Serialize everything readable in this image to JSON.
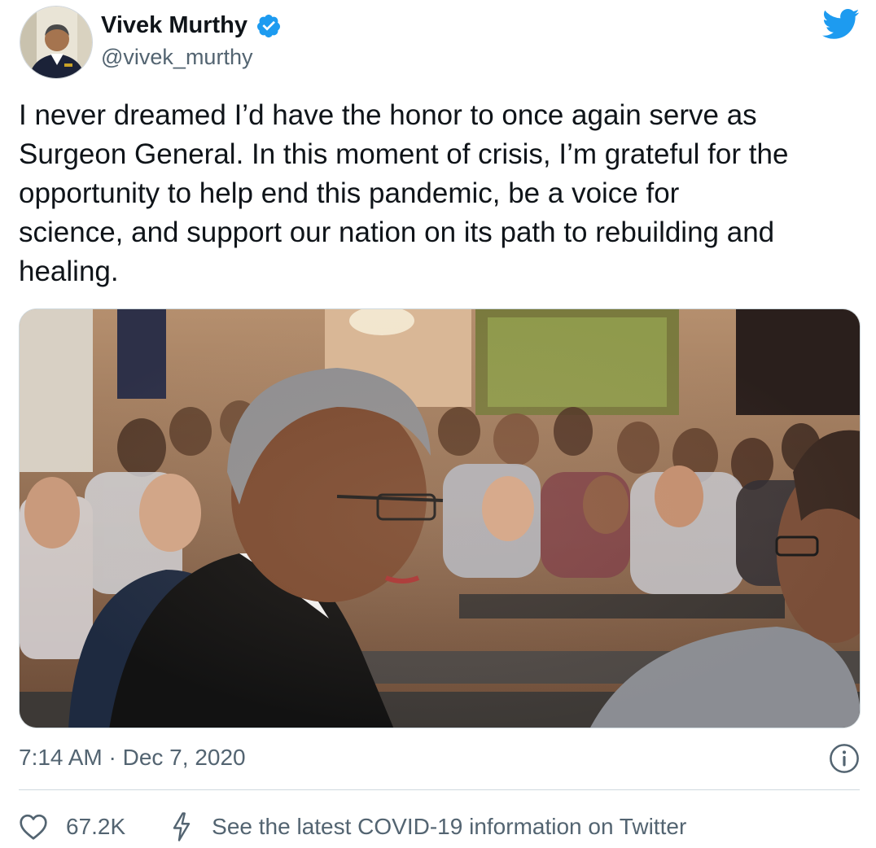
{
  "author": {
    "display_name": "Vivek Murthy",
    "handle": "@vivek_murthy",
    "verified": true,
    "avatar_icon": "profile-photo"
  },
  "tweet": {
    "text": "I never dreamed I’d have the honor to once again serve as\nSurgeon General. In this moment of crisis, I’m grateful for the\nopportunity to help end this pandemic, be a voice for\nscience, and support our nation on its path to rebuilding and\nhealing.",
    "media_icon": "photo",
    "timestamp": "7:14 AM · Dec 7, 2020"
  },
  "footer": {
    "likes": "67.2K",
    "covid_link": "See the latest COVID-19 information on Twitter"
  },
  "colors": {
    "brand_blue": "#1d9bf0",
    "text": "#0f1419",
    "secondary": "#536471",
    "divider": "#cfd9de"
  },
  "icons": {
    "brand": "twitter-bird-icon",
    "verified": "verified-badge-icon",
    "info": "info-icon",
    "like": "heart-icon",
    "bolt": "lightning-bolt-icon"
  }
}
